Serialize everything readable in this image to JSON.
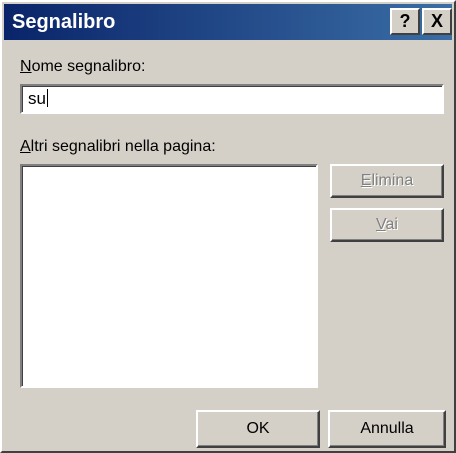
{
  "window": {
    "title": "Segnalibro",
    "help_button": "?",
    "close_button": "X"
  },
  "name_field": {
    "label_acc": "N",
    "label_rest": "ome segnalibro:",
    "value": "su"
  },
  "other_bookmarks": {
    "label_acc": "A",
    "label_rest": "ltri segnalibri nella pagina:",
    "items": []
  },
  "buttons": {
    "delete_acc": "E",
    "delete_rest": "limina",
    "goto_acc": "V",
    "goto_rest": "ai",
    "ok": "OK",
    "cancel": "Annulla"
  },
  "colors": {
    "titlebar_start": "#0a246a",
    "titlebar_end": "#3a6ea5",
    "dialog_bg": "#d4d0c8"
  }
}
